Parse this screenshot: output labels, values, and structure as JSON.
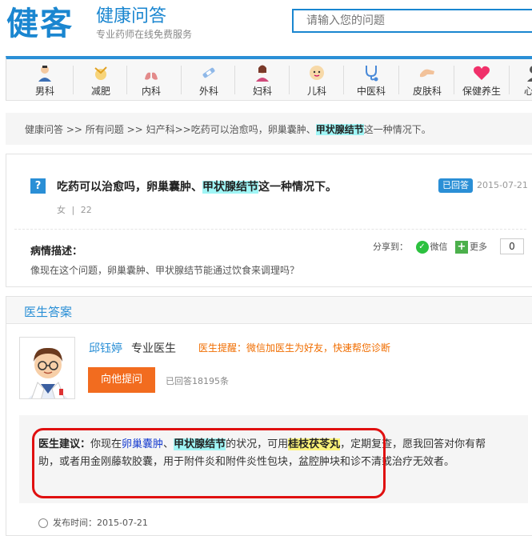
{
  "header": {
    "logo": "健客",
    "title": "健康问答",
    "subtitle": "专业药师在线免费服务",
    "search_placeholder": "请输入您的问题"
  },
  "nav": [
    {
      "label": "男科",
      "icon": "male-doctor-icon"
    },
    {
      "label": "减肥",
      "icon": "weight-loss-icon"
    },
    {
      "label": "内科",
      "icon": "lungs-icon"
    },
    {
      "label": "外科",
      "icon": "surgery-icon"
    },
    {
      "label": "妇科",
      "icon": "female-icon"
    },
    {
      "label": "儿科",
      "icon": "baby-icon"
    },
    {
      "label": "中医科",
      "icon": "stethoscope-icon"
    },
    {
      "label": "皮肤科",
      "icon": "skin-hand-icon"
    },
    {
      "label": "保健养生",
      "icon": "heart-icon"
    },
    {
      "label": "心理",
      "icon": "person-icon"
    }
  ],
  "breadcrumb": {
    "home": "健康问答",
    "sep1": ">>",
    "all": "所有问题",
    "sep2": ">>",
    "category": "妇产科",
    "sep3": ">>",
    "q_pre": "吃药可以治愈吗，卵巢囊肿、",
    "q_hl": "甲状腺结节",
    "q_post": "这一种情况下。"
  },
  "question": {
    "title_pre": "吃药可以治愈吗，卵巢囊肿、",
    "title_hl": "甲状腺结节",
    "title_post": "这一种情况下。",
    "gender": "女",
    "meta_sep": "|",
    "age": "22",
    "badge": "已回答",
    "date": "2015-07-21",
    "desc_label": "病情描述：",
    "desc_text": "像现在这个问题，卵巢囊肿、甲状腺结节能通过饮食来调理吗？",
    "share_label": "分享到：",
    "share_wechat": "微信",
    "share_more": "更多",
    "share_count": "0"
  },
  "answer": {
    "panel_title": "医生答案",
    "doctor_name": "邱钰婷",
    "doctor_title": "专业医生",
    "tip": "医生提醒：微信加医生为好友，快速帮您诊断",
    "ask_button": "向他提问",
    "answered_count": "已回答18195条",
    "advice_label": "医生建议：",
    "advice_1": "你现在",
    "advice_link": "卵巢囊肿",
    "advice_2": "、",
    "advice_hl": "甲状腺结节",
    "advice_3": "的状况，可用",
    "advice_drug": "桂枝茯苓丸",
    "advice_4": "，定期复查，愿我回答对你有帮助，或者用金刚藤软胶囊，用于附件炎和附件炎性包块，盆腔肿块和诊不清或治疗无效者。",
    "pub_label": "发布时间：",
    "pub_date": "2015-07-21"
  },
  "colors": {
    "brand_blue": "#1a86d0",
    "accent_orange": "#f26c1f",
    "highlight_cyan": "#9ff5f5",
    "highlight_yellow": "#fcf37a",
    "outline_red": "#e01010"
  }
}
